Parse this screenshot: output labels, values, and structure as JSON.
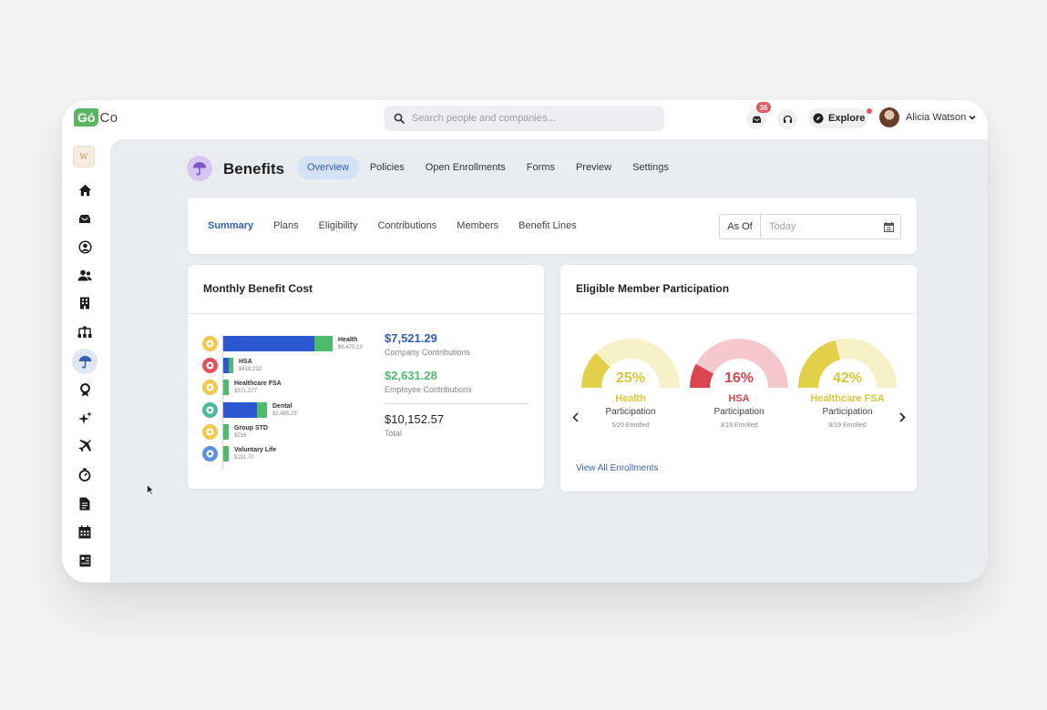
{
  "topbar": {
    "logo_go": "Gó",
    "logo_co": "Co",
    "search_placeholder": "Search people and companies...",
    "inbox_badge": "36",
    "explore_label": "Explore",
    "user_name": "Alicia Watson"
  },
  "sidebar": {
    "org_initial": "W",
    "items": [
      "home",
      "inbox",
      "profile",
      "people",
      "company",
      "org-chart",
      "benefits",
      "awards",
      "sparkle",
      "travel",
      "time",
      "documents",
      "calendar",
      "reports"
    ],
    "active": "benefits"
  },
  "header": {
    "title": "Benefits",
    "tabs": [
      "Overview",
      "Policies",
      "Open Enrollments",
      "Forms",
      "Preview",
      "Settings"
    ],
    "active_tab": "Overview"
  },
  "subnav": {
    "tabs": [
      "Summary",
      "Plans",
      "Eligibility",
      "Contributions",
      "Members",
      "Benefit Lines"
    ],
    "active_tab": "Summary",
    "asof_label": "As Of",
    "date_placeholder": "Today"
  },
  "cost": {
    "title": "Monthly Benefit Cost",
    "rows": [
      {
        "name": "Health",
        "amount": "$6,470.13",
        "company": 0.79,
        "employee": 0.16,
        "color": "#f2c94c"
      },
      {
        "name": "HSA",
        "amount": "$418.232",
        "company": 0.05,
        "employee": 0.04,
        "color": "#e0525c"
      },
      {
        "name": "Healthcare FSA",
        "amount": "$371.277",
        "company": 0.0,
        "employee": 0.05,
        "color": "#f2c94c"
      },
      {
        "name": "Dental",
        "amount": "$2,485.23",
        "company": 0.29,
        "employee": 0.09,
        "color": "#4fb9a0"
      },
      {
        "name": "Group STD",
        "amount": "$216",
        "company": 0.0,
        "employee": 0.05,
        "color": "#f2c94c"
      },
      {
        "name": "Voluntary Life",
        "amount": "$191.70",
        "company": 0.0,
        "employee": 0.05,
        "color": "#5a8fdc"
      }
    ],
    "company_total": "$7,521.29",
    "company_label": "Company Contributions",
    "employee_total": "$2,631.28",
    "employee_label": "Employee Contributions",
    "grand_total": "$10,152.57",
    "total_label": "Total",
    "company_color": "#2b58d0",
    "employee_color": "#4dbb6c"
  },
  "participation": {
    "title": "Eligible Member Participation",
    "gauges": [
      {
        "pct": "25%",
        "value": 0.25,
        "name": "Health",
        "label": "Participation",
        "enrolled": "5/20 Enrolled",
        "color": "#e3d04a",
        "track": "#f7f1c8",
        "text_color": "#d9c63a"
      },
      {
        "pct": "16%",
        "value": 0.16,
        "name": "HSA",
        "label": "Participation",
        "enrolled": "3/19 Enrolled",
        "color": "#d9444e",
        "track": "#f4c8cc",
        "text_color": "#d9444e"
      },
      {
        "pct": "42%",
        "value": 0.42,
        "name": "Healthcare FSA",
        "label": "Participation",
        "enrolled": "8/19 Enrolled",
        "color": "#e3d04a",
        "track": "#f7f1c8",
        "text_color": "#d9c63a"
      }
    ],
    "view_all": "View All Enrollments"
  }
}
